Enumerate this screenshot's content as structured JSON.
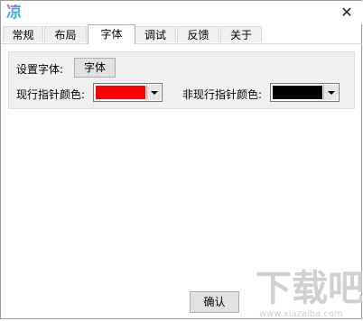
{
  "window": {
    "icon": "凉",
    "close": "✕"
  },
  "tabs": [
    {
      "label": "常规"
    },
    {
      "label": "布局"
    },
    {
      "label": "字体"
    },
    {
      "label": "调试"
    },
    {
      "label": "反馈"
    },
    {
      "label": "关于"
    }
  ],
  "font_section": {
    "set_font_label": "设置字体:",
    "font_button_label": "字体",
    "current_line_color_label": "现行指针颜色:",
    "current_line_color": "#ff0000",
    "other_line_color_label": "非现行指针颜色:",
    "other_line_color": "#000000"
  },
  "footer": {
    "ok_label": "确认"
  },
  "watermark": {
    "text": "下载吧",
    "subtext": "www.xiazaiba.com"
  }
}
